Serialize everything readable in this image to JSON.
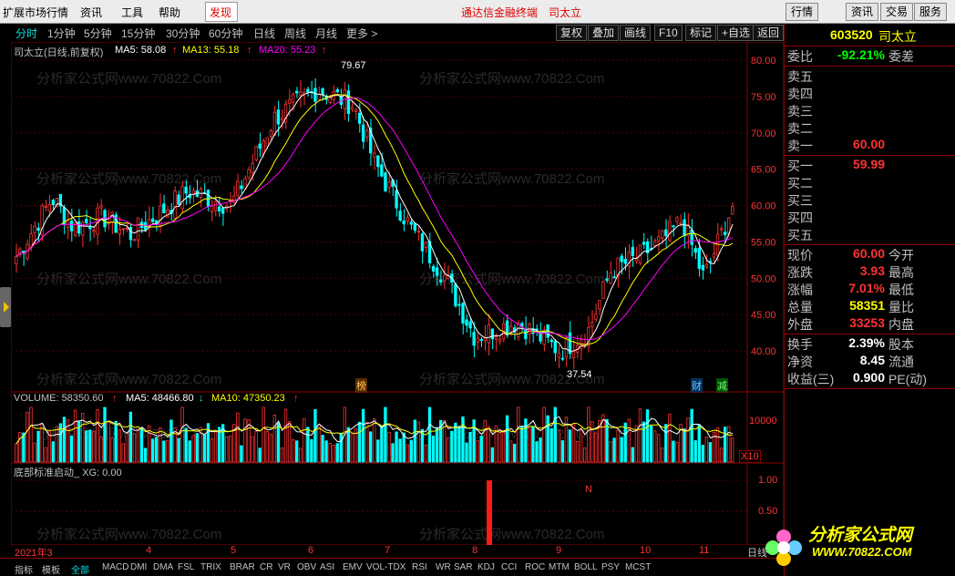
{
  "menu": {
    "items": [
      "扩展市场行情",
      "资讯",
      "工具",
      "帮助"
    ],
    "discover": "发现",
    "center_title": "通达信金融终端",
    "center_stock": "司太立",
    "right_buttons": [
      "行情",
      "资讯",
      "交易",
      "服务"
    ]
  },
  "periods": {
    "items": [
      "分时",
      "1分钟",
      "5分钟",
      "15分钟",
      "30分钟",
      "60分钟",
      "日线",
      "周线",
      "月线",
      "更多 >"
    ],
    "active": "分时"
  },
  "toolbar": {
    "buttons": [
      "复权",
      "叠加",
      "画线",
      "F10",
      "标记",
      "+自选",
      "返回"
    ]
  },
  "main_chart": {
    "title": "司太立(日线,前复权)",
    "ma5": "MA5: 58.08",
    "ma13": "MA13: 55.18",
    "ma20": "MA20: 55.23",
    "high_label": "79.67",
    "low_label": "37.54",
    "badge_bang": "榜",
    "badge_cai": "财",
    "badge_jian": "减",
    "colors": {
      "up": "#ff3232",
      "down": "#00ffff",
      "ma5": "#ffffff",
      "ma13": "#ffff00",
      "ma20": "#ff00ff"
    }
  },
  "volume_panel": {
    "title": "VOLUME: 58350.60",
    "ma5": "MA5: 48466.80",
    "ma10": "MA10: 47350.23",
    "axis_label": "10000",
    "unit": "X10"
  },
  "indicator_panel": {
    "title": "底部标准启动_ XG: 0.00",
    "axis_1": "1.00",
    "axis_05": "0.50",
    "marker": "N"
  },
  "date_axis": {
    "labels": [
      "2021年3",
      "4",
      "5",
      "6",
      "7",
      "8",
      "9",
      "10",
      "11"
    ],
    "corner": "日线"
  },
  "bottom_tabs": {
    "items": [
      "指标",
      "模板",
      "全部",
      "MACD",
      "DMI",
      "DMA",
      "FSL",
      "TRIX",
      "BRAR",
      "CR",
      "VR",
      "OBV",
      "ASI",
      "EMV",
      "VOL-TDX",
      "RSI",
      "WR",
      "SAR",
      "KDJ",
      "CCI",
      "ROC",
      "MTM",
      "BOLL",
      "PSY",
      "MCST"
    ],
    "active": "全部"
  },
  "quote": {
    "code": "603520",
    "name": "司太立",
    "weibi_label": "委比",
    "weibi_value": "-92.21%",
    "weicha_label": "委差",
    "sell": [
      {
        "label": "卖五",
        "price": ""
      },
      {
        "label": "卖四",
        "price": ""
      },
      {
        "label": "卖三",
        "price": ""
      },
      {
        "label": "卖二",
        "price": ""
      },
      {
        "label": "卖一",
        "price": "60.00"
      }
    ],
    "buy": [
      {
        "label": "买一",
        "price": "59.99"
      },
      {
        "label": "买二",
        "price": ""
      },
      {
        "label": "买三",
        "price": ""
      },
      {
        "label": "买四",
        "price": ""
      },
      {
        "label": "买五",
        "price": ""
      }
    ],
    "stats": [
      {
        "k": "现价",
        "v": "60.00",
        "k2": "今开",
        "color": "#ff3232"
      },
      {
        "k": "涨跌",
        "v": "3.93",
        "k2": "最高",
        "color": "#ff3232"
      },
      {
        "k": "涨幅",
        "v": "7.01%",
        "k2": "最低",
        "color": "#ff3232"
      },
      {
        "k": "总量",
        "v": "58351",
        "k2": "量比",
        "color": "#ffff00"
      },
      {
        "k": "外盘",
        "v": "33253",
        "k2": "内盘",
        "color": "#ff3232"
      },
      {
        "k": "换手",
        "v": "2.39%",
        "k2": "股本",
        "color": "#ffffff"
      },
      {
        "k": "净资",
        "v": "8.45",
        "k2": "流通",
        "color": "#ffffff"
      },
      {
        "k": "收益(三)",
        "v": "0.900",
        "k2": "PE(动)",
        "color": "#ffffff"
      }
    ]
  },
  "price_axis": [
    "80.00",
    "75.00",
    "70.00",
    "65.00",
    "60.00",
    "55.00",
    "50.00",
    "45.00",
    "40.00"
  ],
  "watermark": {
    "site": "分析家公式网www.70822.Com",
    "logo_text": "分析家公式网",
    "logo_url": "WWW.70822.COM"
  }
}
